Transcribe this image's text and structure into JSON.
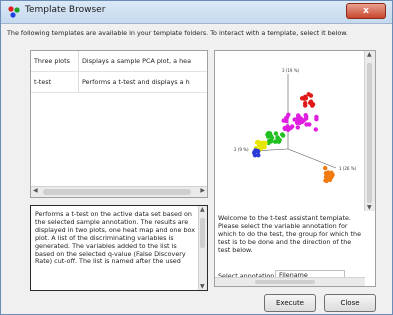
{
  "window": {
    "title": "Template Browser",
    "close_label": "x"
  },
  "instruction": "The following templates are available in your template folders. To interact with a template, select it below.",
  "templates": [
    {
      "name": "Three plots",
      "description": "Displays a sample PCA plot, a hea"
    },
    {
      "name": "t-test",
      "description": "Performs a t-test and displays a h"
    }
  ],
  "description_text": "Performs a t-test on the active data set based on the selected sample annotation. The results are displayed in two plots, one heat map and one box plot. A list of the discriminating variables is generated. The variables added to the list is based on the selected q-value (False Discovery Rate) cut-off. The list is named after the used",
  "plot": {
    "axis_label_top": "3 (19 %)",
    "axis_label_right": "1 (26 %)",
    "axis_label_left": "2 (9 %)",
    "colors": {
      "magenta": "#e01ee0",
      "red": "#e01818",
      "green": "#20c020",
      "yellow": "#e6e600",
      "blue": "#2a3ad8",
      "orange": "#f07a10"
    }
  },
  "welcome_text": "Welcome to the t-test assistant template. Please select the variable annotation for which to do the test, the group for which the test is to be done and the direction of the test below.",
  "select_annotation_label": "Select annotation",
  "filename_value": "Filename",
  "buttons": {
    "execute": "Execute",
    "close": "Close"
  }
}
